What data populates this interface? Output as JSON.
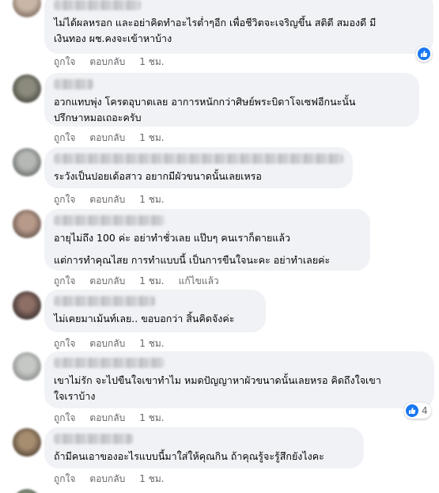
{
  "labels": {
    "like": "ถูกใจ",
    "reply": "ตอบกลับ",
    "edited": "แก้ไขแล้ว"
  },
  "comments": [
    {
      "lines": [
        "ไม่ได้ผลหรอก และอย่าคิดทำอะไรต่ำๆอีก เพื่อชีวิตจะเจริญขึ้น สติดี สมองดี มี",
        "เงินทอง ผช.คงจะเข้าหาบ้าง"
      ],
      "time": "1 ชม.",
      "reaction_count": ""
    },
    {
      "lines": [
        "อวกแทบพุ่ง โครตอุบาตเลย อาการหนักกว่าศิษย์พระบิดาโจเซฟอีกนะนั้น",
        "ปรึกษาหมอเถอะครับ"
      ],
      "time": "1 ชม."
    },
    {
      "lines": [
        "ระวังเป็นปอยเด้อสาว อยากมีผัวขนาดนั้นเลยเหรอ"
      ],
      "time": "1 ชม."
    },
    {
      "lines": [
        "อายุไม่ถึง 100 ค่ะ อย่าทำชั่วเลย แป๊บๆ คนเราก็ตายแล้ว",
        "แต่การทำคุณไสย การทำแบบนี้ เป็นการขืนใจนะคะ อย่าทำเลยค่ะ"
      ],
      "time": "1 ชม."
    },
    {
      "lines": [
        "ไม่เคยมาเม้นท์เลย.. ขอบอกว่า สิ้นคิดจังค่ะ"
      ],
      "time": "1 ชม."
    },
    {
      "lines": [
        "เขาไม่รัก จะไปขืนใจเขาทำไม หมดปัญญาหาผัวขนาดนั้นเลยหรอ คิดถึงใจเขา",
        "ใจเราบ้าง"
      ],
      "time": "1 ชม.",
      "reaction_count": "4"
    },
    {
      "lines": [
        "ถ้ามีคนเอาของอะไรแบบนี้มาใส่ให้คุณกิน ถ้าคุณรู้จะรู้สึกยังไงคะ"
      ],
      "time": "1 ชม."
    }
  ],
  "colors": {
    "bubble": "#f0f2f5",
    "meta": "#65676b",
    "like_blue": "#1877f2"
  },
  "icons": [
    "thumbs-up-icon"
  ]
}
